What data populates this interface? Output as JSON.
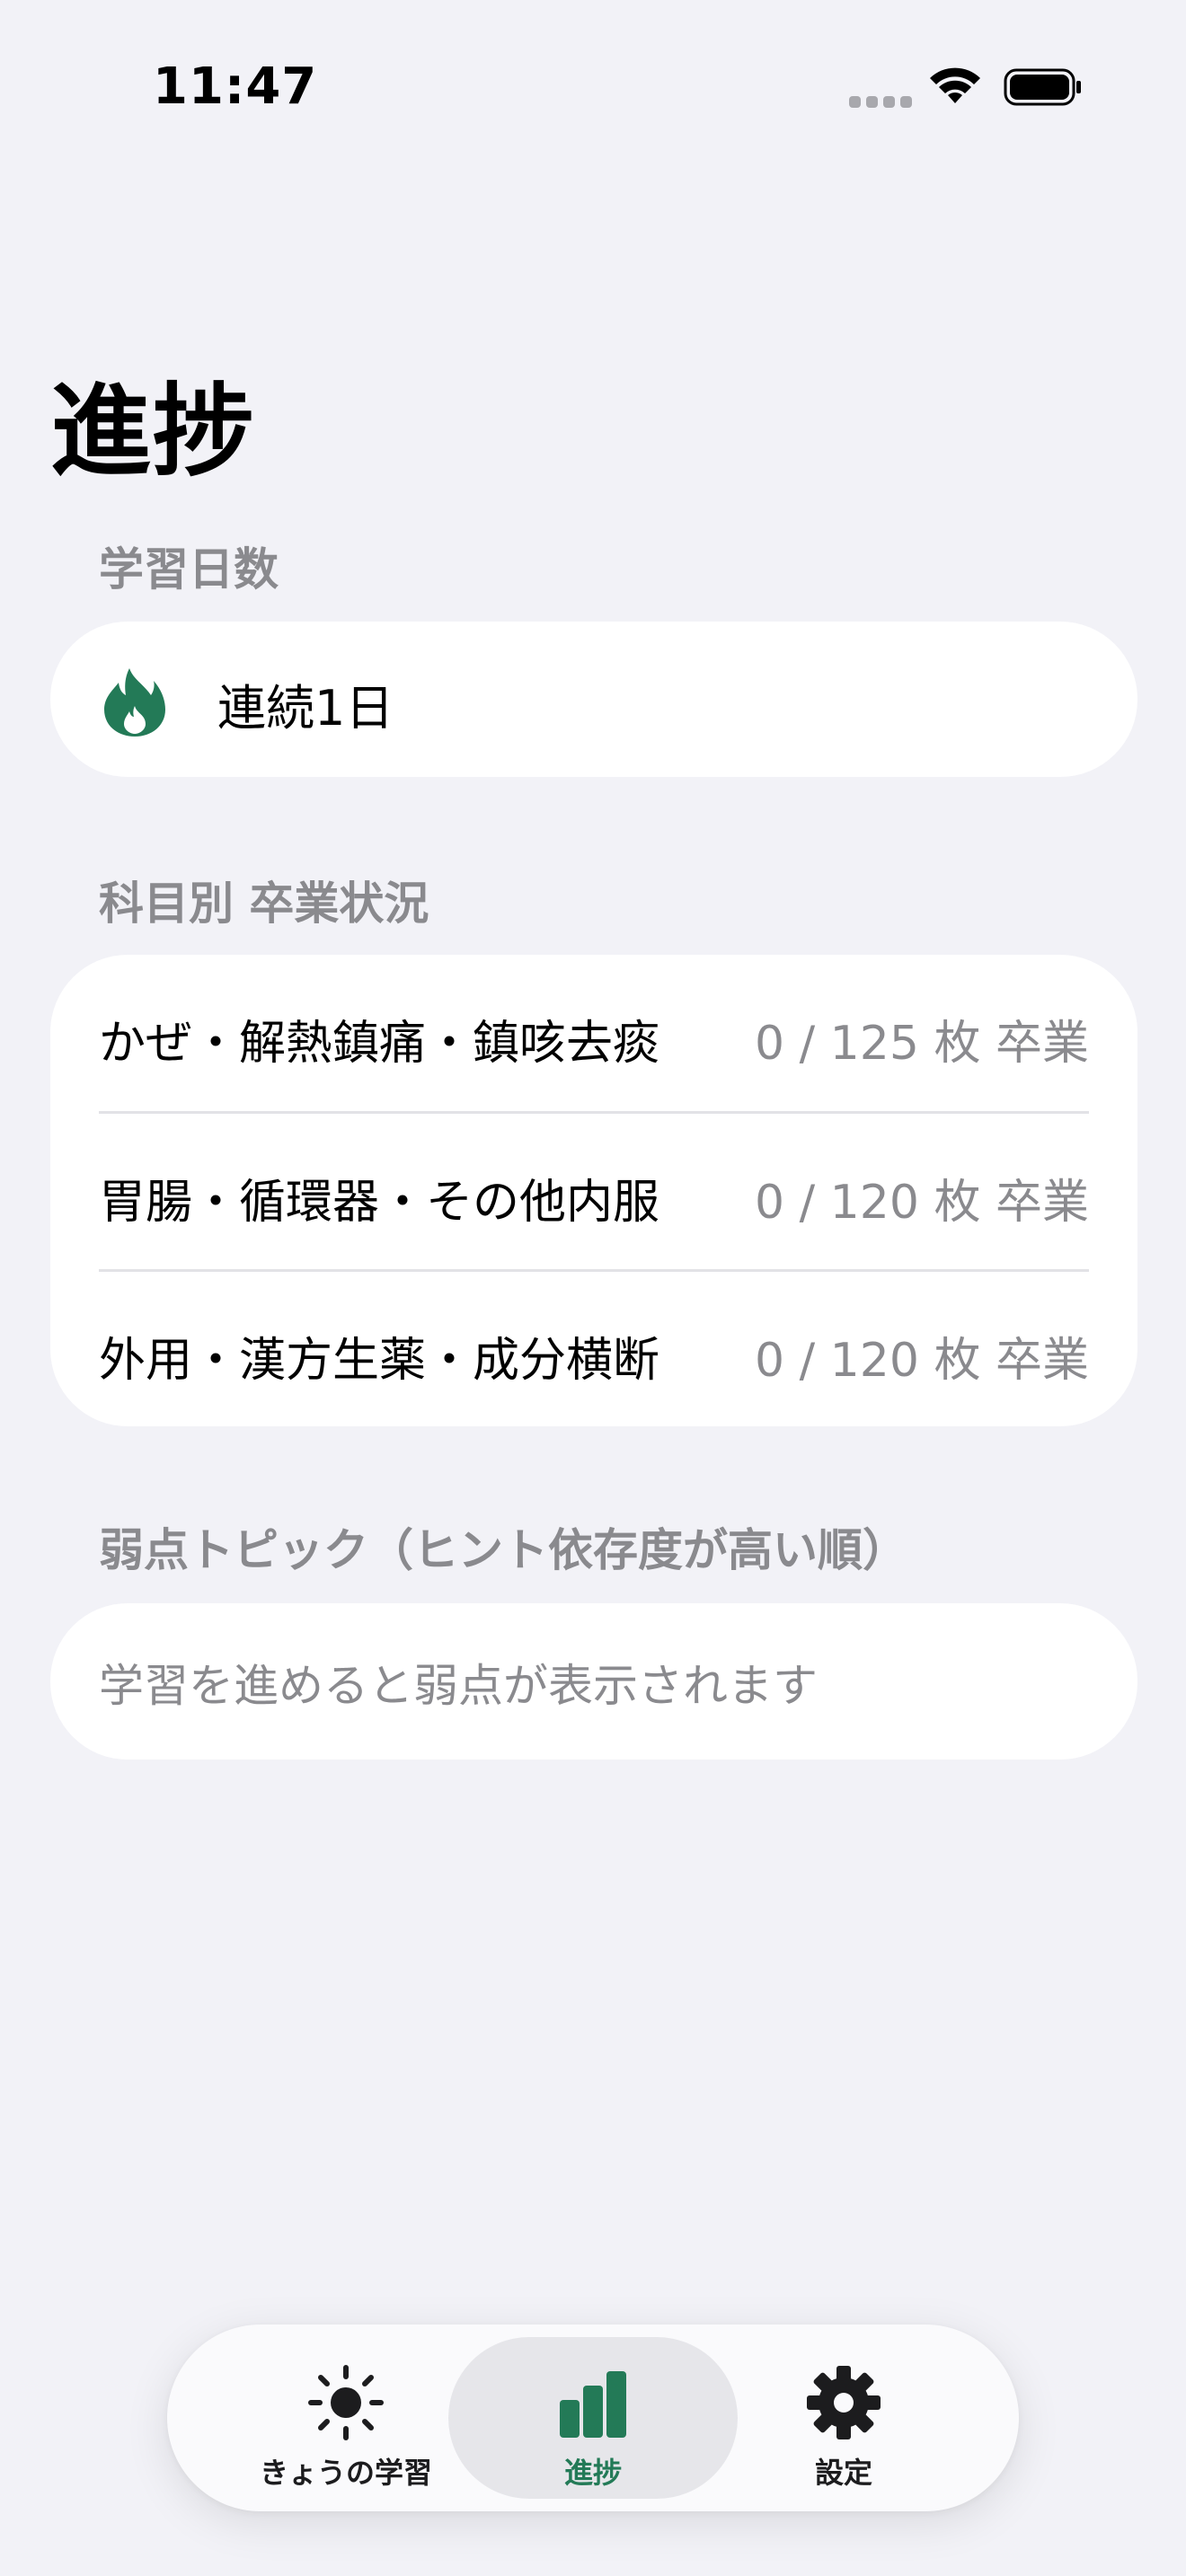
{
  "status_bar": {
    "time": "11:47"
  },
  "page": {
    "title": "進捗"
  },
  "streak_section": {
    "header": "学習日数",
    "text": "連続1日",
    "icon": "flame-icon",
    "accent": "#237a57"
  },
  "graduation_section": {
    "header": "科目別 卒業状況",
    "rows": [
      {
        "name": "かぜ・解熱鎮痛・鎮咳去痰",
        "count": "0 / 125 枚 卒業"
      },
      {
        "name": "胃腸・循環器・その他内服",
        "count": "0 / 120 枚 卒業"
      },
      {
        "name": "外用・漢方生薬・成分横断",
        "count": "0 / 120 枚 卒業"
      }
    ]
  },
  "weak_section": {
    "header": "弱点トピック（ヒント依存度が高い順）",
    "empty_message": "学習を進めると弱点が表示されます"
  },
  "tab_bar": {
    "active_color": "#237a57",
    "items": [
      {
        "label": "きょうの学習",
        "icon": "sun-icon",
        "active": false
      },
      {
        "label": "進捗",
        "icon": "bar-chart-icon",
        "active": true
      },
      {
        "label": "設定",
        "icon": "gear-icon",
        "active": false
      }
    ]
  }
}
